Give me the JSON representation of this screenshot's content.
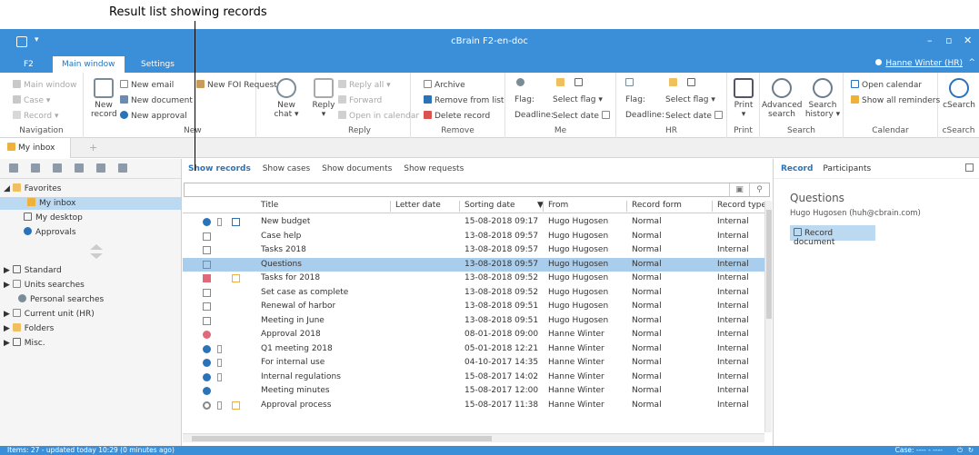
{
  "callout": {
    "text": "Result list showing records"
  },
  "window": {
    "title": "cBrain F2-en-doc"
  },
  "ribbon_tabs": [
    {
      "label": "F2"
    },
    {
      "label": "Main window"
    },
    {
      "label": "Settings"
    }
  ],
  "user": {
    "name": "Hanne Winter (HR)"
  },
  "ribbon": {
    "navigation": {
      "items": [
        "Main window",
        "Case",
        "Record"
      ],
      "label": "Navigation"
    },
    "new": {
      "new_record": "New record",
      "new_email": "New email",
      "new_document": "New document",
      "new_approval": "New approval",
      "new_foi": "New FOI Request",
      "new_chat": "New chat",
      "label": "New"
    },
    "reply": {
      "reply": "Reply",
      "reply_all": "Reply all",
      "forward": "Forward",
      "open_in_calendar": "Open in calendar",
      "label": "Reply"
    },
    "remove": {
      "archive": "Archive",
      "remove_from_list": "Remove from list",
      "delete_record": "Delete record",
      "label": "Remove"
    },
    "me": {
      "flag": "Flag:",
      "deadline": "Deadline:",
      "select_flag": "Select flag",
      "select_date": "Select date",
      "label": "Me"
    },
    "hr": {
      "flag": "Flag:",
      "deadline": "Deadline:",
      "select_flag": "Select flag",
      "select_date": "Select date",
      "label": "HR"
    },
    "print": {
      "print": "Print",
      "label": "Print"
    },
    "search": {
      "advanced": "Advanced search",
      "history": "Search history",
      "label": "Search"
    },
    "calendar": {
      "open": "Open calendar",
      "reminders": "Show all reminders",
      "label": "Calendar"
    },
    "csearch": {
      "csearch": "cSearch",
      "label": "cSearch"
    }
  },
  "doc_tab": {
    "label": "My inbox"
  },
  "tree": {
    "favorites": "Favorites",
    "my_inbox": "My inbox",
    "my_desktop": "My desktop",
    "approvals": "Approvals",
    "standard": "Standard",
    "units_searches": "Units searches",
    "personal_searches": "Personal searches",
    "current_unit": "Current unit (HR)",
    "folders": "Folders",
    "misc": "Misc."
  },
  "subtabs": [
    {
      "label": "Show records"
    },
    {
      "label": "Show cases"
    },
    {
      "label": "Show documents"
    },
    {
      "label": "Show requests"
    }
  ],
  "columns": [
    "Title",
    "Letter date",
    "Sorting date",
    "From",
    "Record form",
    "Record type"
  ],
  "rows": [
    {
      "title": "New budget",
      "sorting_date": "15-08-2018 09:17",
      "from": "Hugo Hugosen",
      "form": "Normal",
      "type": "Internal"
    },
    {
      "title": "Case help",
      "sorting_date": "13-08-2018 09:57",
      "from": "Hugo Hugosen",
      "form": "Normal",
      "type": "Internal"
    },
    {
      "title": "Tasks 2018",
      "sorting_date": "13-08-2018 09:57",
      "from": "Hugo Hugosen",
      "form": "Normal",
      "type": "Internal"
    },
    {
      "title": "Questions",
      "sorting_date": "13-08-2018 09:57",
      "from": "Hugo Hugosen",
      "form": "Normal",
      "type": "Internal"
    },
    {
      "title": "Tasks for 2018",
      "sorting_date": "13-08-2018 09:52",
      "from": "Hugo Hugosen",
      "form": "Normal",
      "type": "Internal"
    },
    {
      "title": "Set case as complete",
      "sorting_date": "13-08-2018 09:52",
      "from": "Hugo Hugosen",
      "form": "Normal",
      "type": "Internal"
    },
    {
      "title": "Renewal of harbor",
      "sorting_date": "13-08-2018 09:51",
      "from": "Hugo Hugosen",
      "form": "Normal",
      "type": "Internal"
    },
    {
      "title": "Meeting in June",
      "sorting_date": "13-08-2018 09:51",
      "from": "Hugo Hugosen",
      "form": "Normal",
      "type": "Internal"
    },
    {
      "title": "Approval 2018",
      "sorting_date": "08-01-2018 09:00",
      "from": "Hanne Winter",
      "form": "Normal",
      "type": "Internal"
    },
    {
      "title": "Q1 meeting 2018",
      "sorting_date": "05-01-2018 12:21",
      "from": "Hanne Winter",
      "form": "Normal",
      "type": "Internal"
    },
    {
      "title": "For internal use",
      "sorting_date": "04-10-2017 14:35",
      "from": "Hanne Winter",
      "form": "Normal",
      "type": "Internal"
    },
    {
      "title": "Internal regulations",
      "sorting_date": "15-08-2017 14:02",
      "from": "Hanne Winter",
      "form": "Normal",
      "type": "Internal"
    },
    {
      "title": "Meeting minutes",
      "sorting_date": "15-08-2017 12:00",
      "from": "Hanne Winter",
      "form": "Normal",
      "type": "Internal"
    },
    {
      "title": "Approval process",
      "sorting_date": "15-08-2017 11:38",
      "from": "Hanne Winter",
      "form": "Normal",
      "type": "Internal"
    }
  ],
  "right_tabs": [
    {
      "label": "Record"
    },
    {
      "label": "Participants"
    }
  ],
  "preview": {
    "title": "Questions",
    "from": "Hugo Hugosen (huh@cbrain.com)",
    "document": "Record document"
  },
  "status": {
    "left": "Items: 27 - updated today 10:29 (0 minutes ago)",
    "right": "Case: ---- - ----"
  },
  "colors": {
    "accent": "#3b8fd9",
    "selection": "#a9cdec",
    "tree_selection": "#bcd9f2",
    "link": "#2b73b8"
  }
}
